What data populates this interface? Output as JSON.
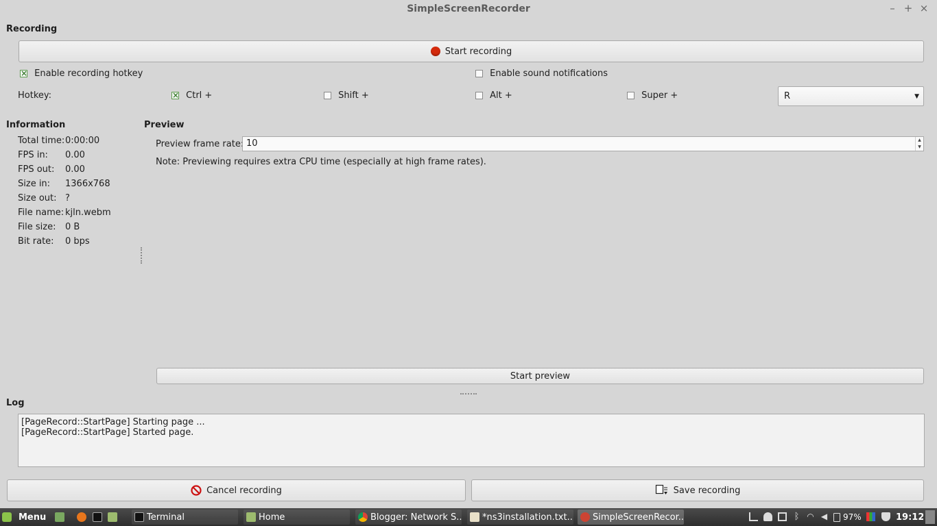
{
  "window": {
    "title": "SimpleScreenRecorder",
    "minimize_glyph": "–",
    "maximize_glyph": "+",
    "close_glyph": "×"
  },
  "recording": {
    "section_title": "Recording",
    "start_button": "Start recording",
    "enable_hotkey_label": "Enable recording hotkey",
    "enable_hotkey_checked": true,
    "sound_notifications_label": "Enable sound notifications",
    "sound_notifications_checked": false,
    "hotkey_label": "Hotkey:",
    "modifiers": [
      {
        "label": "Ctrl +",
        "checked": true
      },
      {
        "label": "Shift +",
        "checked": false
      },
      {
        "label": "Alt +",
        "checked": false
      },
      {
        "label": "Super +",
        "checked": false
      }
    ],
    "hotkey_key": "R"
  },
  "information": {
    "section_title": "Information",
    "rows": [
      {
        "key": "Total time:",
        "value": "0:00:00"
      },
      {
        "key": "FPS in:",
        "value": "0.00"
      },
      {
        "key": "FPS out:",
        "value": "0.00"
      },
      {
        "key": "Size in:",
        "value": "1366x768"
      },
      {
        "key": "Size out:",
        "value": "?"
      },
      {
        "key": "File name:",
        "value": "kjln.webm"
      },
      {
        "key": "File size:",
        "value": "0 B"
      },
      {
        "key": "Bit rate:",
        "value": "0 bps"
      }
    ]
  },
  "preview": {
    "section_title": "Preview",
    "frame_rate_label": "Preview frame rate:",
    "frame_rate_value": "10",
    "note": "Note: Previewing requires extra CPU time (especially at high frame rates).",
    "start_preview_button": "Start preview"
  },
  "log": {
    "section_title": "Log",
    "lines": [
      "[PageRecord::StartPage] Starting page ...",
      "[PageRecord::StartPage] Started page."
    ]
  },
  "actions": {
    "cancel_button": "Cancel recording",
    "save_button": "Save recording"
  },
  "taskbar": {
    "menu_label": "Menu",
    "tasks": [
      {
        "label": "Terminal",
        "active": false
      },
      {
        "label": "Home",
        "active": false
      },
      {
        "label": "Blogger: Network S...",
        "active": false
      },
      {
        "label": "*ns3installation.txt...",
        "active": false
      },
      {
        "label": "SimpleScreenRecor...",
        "active": true
      }
    ],
    "battery": "97%",
    "clock": "19:12"
  },
  "colors": {
    "record_red": "#d42a0c",
    "cancel_red": "#cc1111",
    "check_green": "#3f7f34",
    "mint_green": "#8bc34a"
  }
}
